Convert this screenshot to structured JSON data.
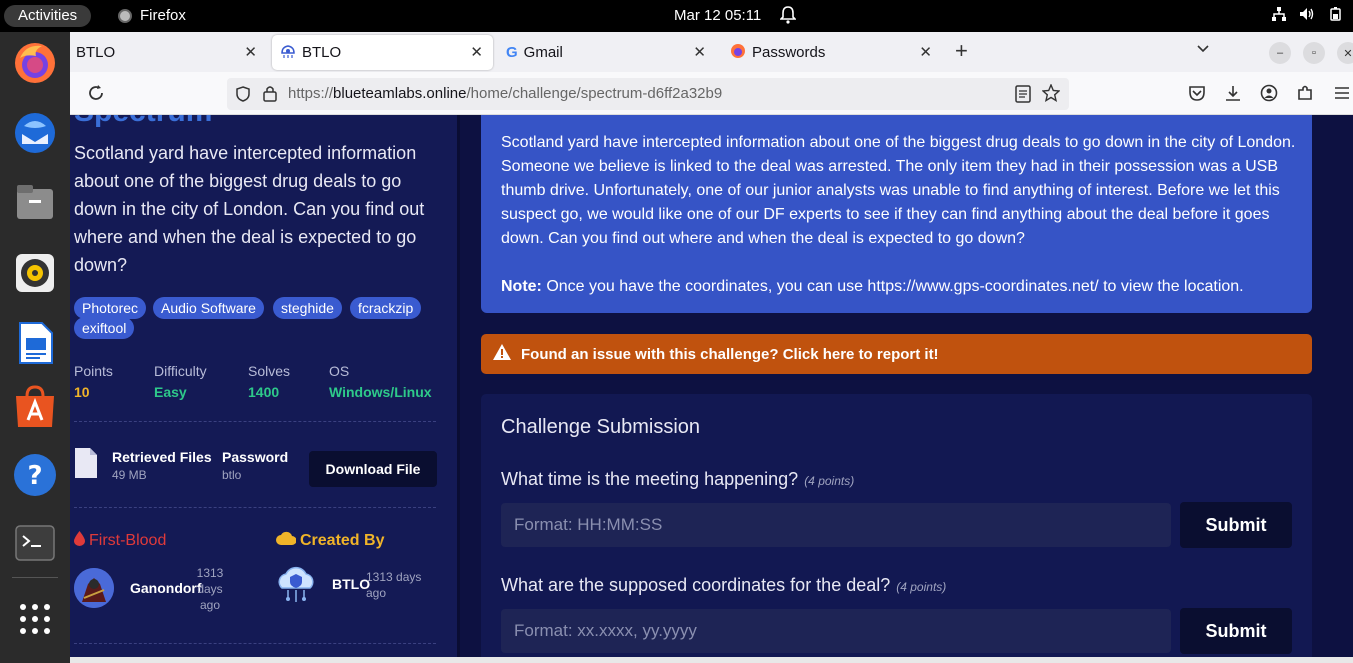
{
  "topbar": {
    "activities": "Activities",
    "app_name": "Firefox",
    "clock": "Mar 12  05:11"
  },
  "tabs": [
    {
      "label": "BTLO",
      "active": false
    },
    {
      "label": "BTLO",
      "active": true
    },
    {
      "label": "Gmail",
      "active": false
    },
    {
      "label": "Passwords",
      "active": false
    }
  ],
  "urlbar": {
    "prefix": "https://",
    "host": "blueteamlabs.online",
    "path": "/home/challenge/spectrum-d6ff2a32b9"
  },
  "challenge": {
    "title": "Spectrum",
    "summary": "Scotland yard have intercepted information about one of the biggest drug deals to go down in the city of London. Can you find out where and when the deal is expected to go down?",
    "tags": [
      "Photorec",
      "Audio Software",
      "steghide",
      "fcrackzip",
      "exiftool"
    ],
    "stats": [
      {
        "label": "Points",
        "value": "10",
        "color": "#f0b429"
      },
      {
        "label": "Difficulty",
        "value": "Easy",
        "color": "#2ec98a"
      },
      {
        "label": "Solves",
        "value": "1400",
        "color": "#2ec98a"
      },
      {
        "label": "OS",
        "value": "Windows/Linux",
        "color": "#2ec98a"
      }
    ],
    "files": {
      "label": "Retrieved Files",
      "size": "49 MB"
    },
    "password": {
      "label": "Password",
      "value": "btlo"
    },
    "download_label": "Download File",
    "first_blood": {
      "heading": "First-Blood",
      "name": "Ganondorf",
      "time": "1313 days ago"
    },
    "created_by": {
      "heading": "Created By",
      "name": "BTLO",
      "time": "1313 days ago"
    }
  },
  "description": {
    "body": "Scotland yard have intercepted information about one of the biggest drug deals to go down in the city of London. Someone we believe is linked to the deal was arrested. The only item they had in their possession was a USB thumb drive. Unfortunately, one of our junior analysts was unable to find anything of interest. Before we let this suspect go, we would like one of our DF experts to see if they can find anything about the deal before it goes down. Can you find out where and when the deal is expected to go down?",
    "note_label": "Note:",
    "note_text": " Once you have the coordinates, you can use https://www.gps-coordinates.net/ to view the location."
  },
  "issue_text": "Found an issue with this challenge? Click here to report it!",
  "submission": {
    "title": "Challenge Submission",
    "questions": [
      {
        "text": "What time is the meeting happening?",
        "points": "(4 points)",
        "placeholder": "Format: HH:MM:SS",
        "submit": "Submit"
      },
      {
        "text": "What are the supposed coordinates for the deal?",
        "points": "(4 points)",
        "placeholder": "Format: xx.xxxx, yy.yyyy",
        "submit": "Submit"
      }
    ]
  }
}
